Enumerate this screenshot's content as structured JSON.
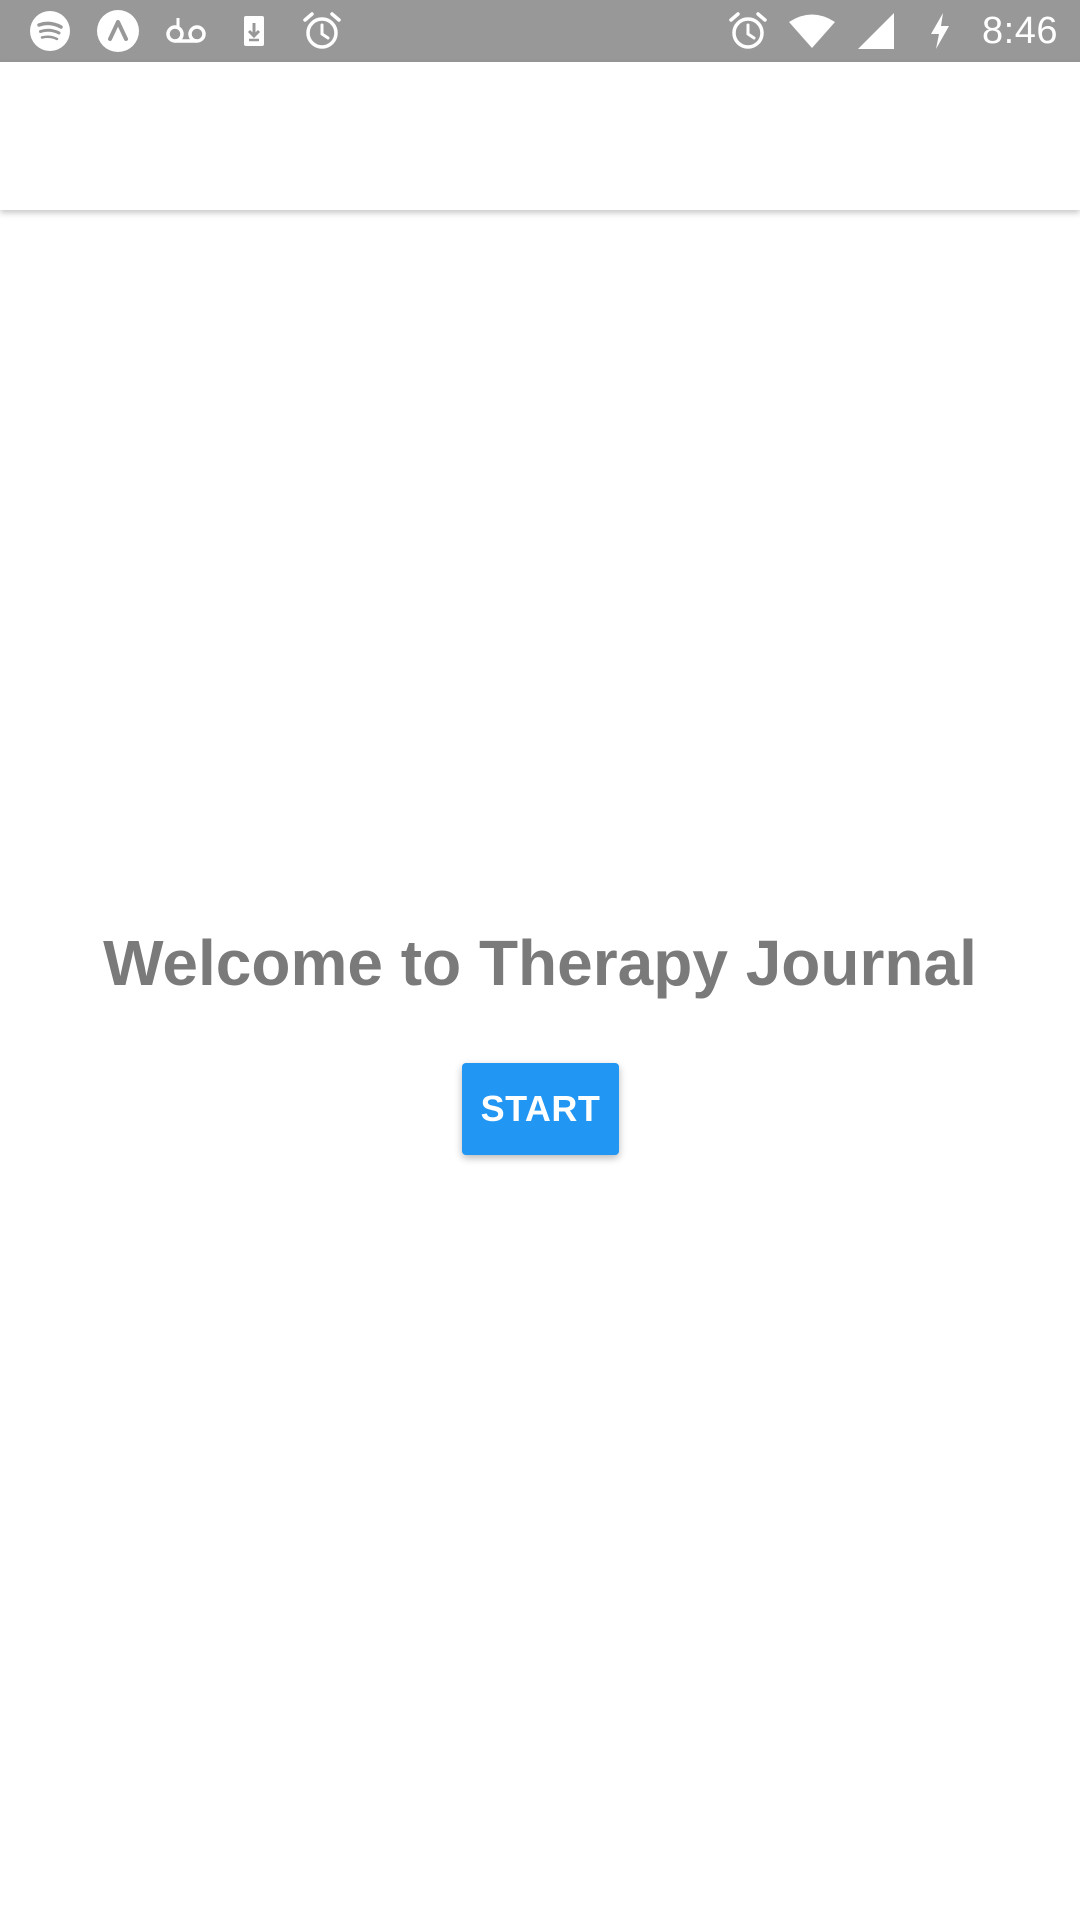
{
  "status_bar": {
    "time": "8:46",
    "background_color": "#989898",
    "left_icons": [
      "spotify-icon",
      "app-a-icon",
      "voicemail-icon",
      "download-icon",
      "alarm-icon"
    ],
    "right_icons": [
      "alarm-icon",
      "wifi-icon",
      "signal-icon",
      "charging-icon"
    ]
  },
  "main": {
    "title": "Welcome to Therapy Journal",
    "start_label": "START",
    "title_color": "#7a7a7a",
    "button_color": "#2196f3"
  }
}
